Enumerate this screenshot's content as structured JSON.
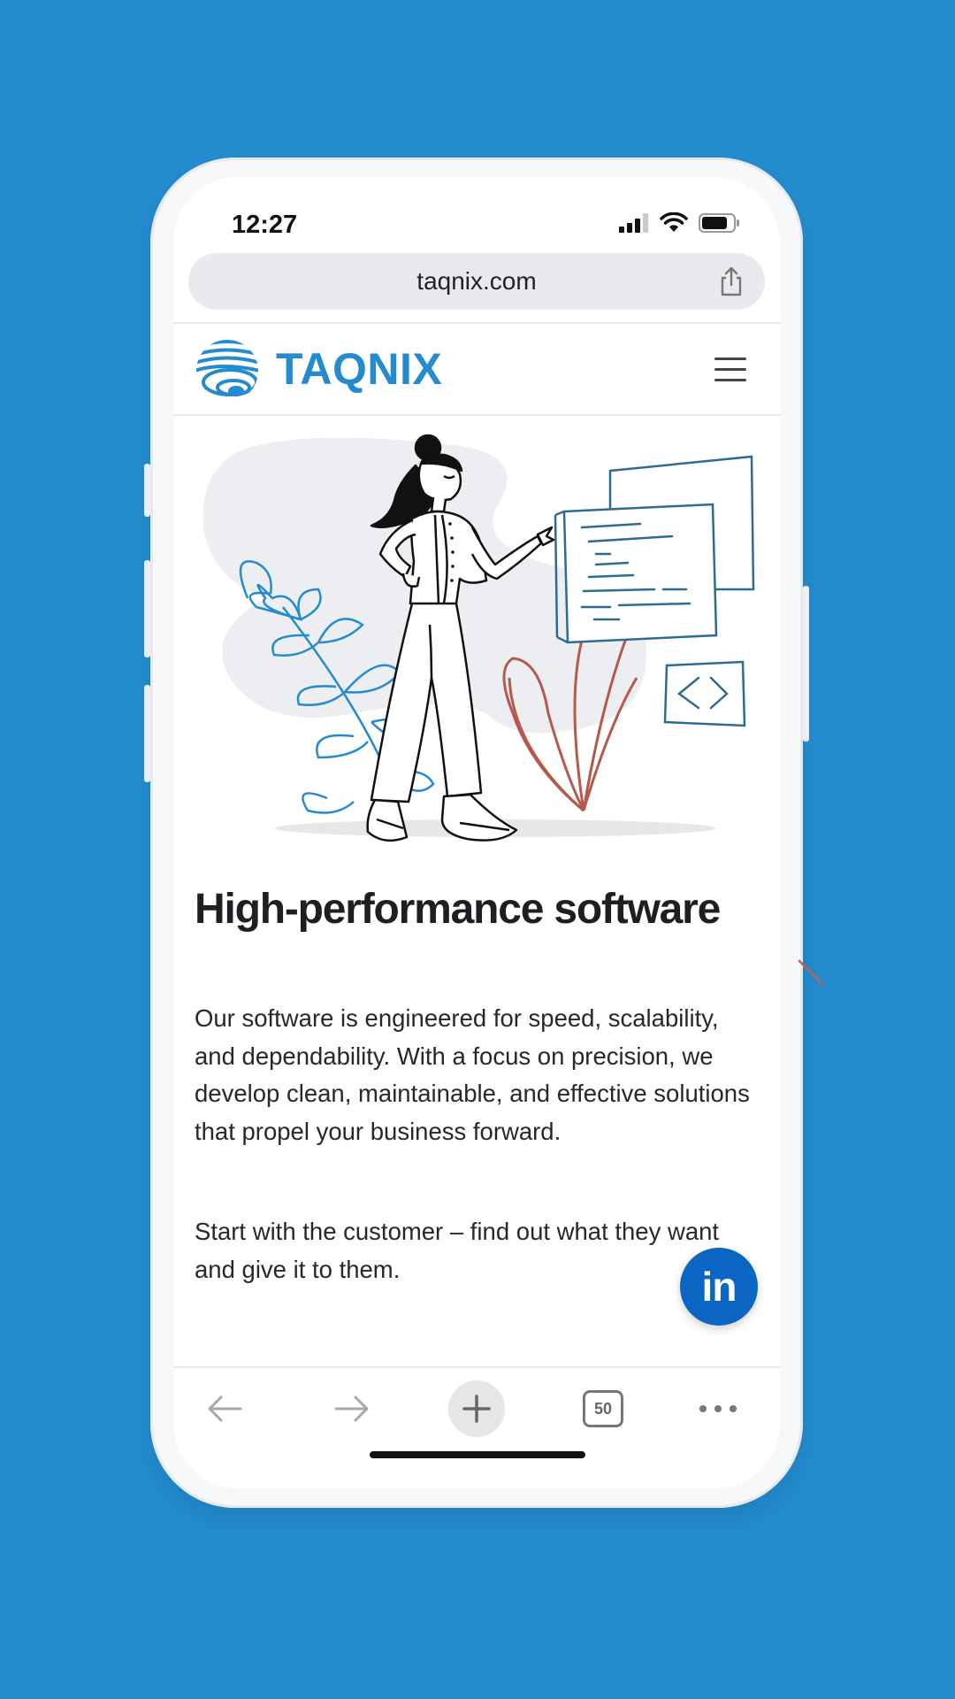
{
  "status": {
    "time": "12:27"
  },
  "browser": {
    "url": "taqnix.com",
    "tabs_count": "50",
    "icons": [
      "share-icon",
      "back-arrow-icon",
      "forward-arrow-icon",
      "new-tab-plus-icon",
      "tabs-icon",
      "more-icon"
    ]
  },
  "site": {
    "brand": "TAQNIX",
    "brand_color": "#238bce",
    "headline": "High-performance software",
    "paragraphs": [
      "Our software is engineered for speed, scalability, and dependability. With a focus on precision, we develop clean, maintainable, and effective solutions that propel your business forward.",
      "Start with the customer – find out what they want and give it to them."
    ]
  },
  "fab": {
    "label": "in",
    "icon": "linkedin-icon",
    "color": "#0a66c2"
  },
  "colors": {
    "background": "#238bce",
    "text": "#1d1f22",
    "plant_red": "#b5594c"
  }
}
